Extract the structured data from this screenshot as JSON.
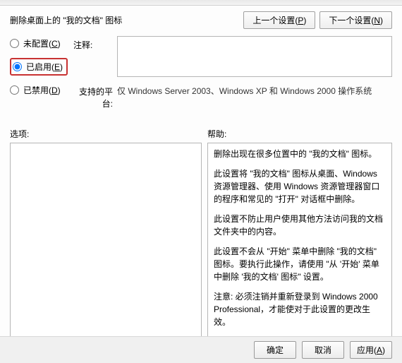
{
  "title": "删除桌面上的 \"我的文档\" 图标",
  "nav": {
    "prev": "上一个设置(P)",
    "next": "下一个设置(N)"
  },
  "radios": {
    "not_configured": "未配置(C)",
    "enabled": "已启用(E)",
    "disabled": "已禁用(D)",
    "selected": "enabled"
  },
  "fields": {
    "comment_label": "注释:",
    "comment_value": "",
    "platform_label": "支持的平台:",
    "platform_value": "仅 Windows Server 2003、Windows XP 和 Windows 2000 操作系统"
  },
  "section_labels": {
    "options": "选项:",
    "help": "帮助:"
  },
  "help_text": {
    "p1": "删除出现在很多位置中的 \"我的文档\" 图标。",
    "p2": "此设置将 \"我的文档\" 图标从桌面、Windows 资源管理器、使用 Windows 资源管理器窗口的程序和常见的 \"打开\" 对话框中删除。",
    "p3": "此设置不防止用户使用其他方法访问我的文档文件夹中的内容。",
    "p4": "此设置不会从 \"开始\" 菜单中删除 \"我的文档\" 图标。要执行此操作，请使用 \"从 '开始' 菜单中删除 '我的文档' 图标\" 设置。",
    "p5": "注意: 必须注销并重新登录到 Windows 2000 Professional，才能使对于此设置的更改生效。"
  },
  "buttons": {
    "ok": "确定",
    "cancel": "取消",
    "apply": "应用(A)"
  }
}
